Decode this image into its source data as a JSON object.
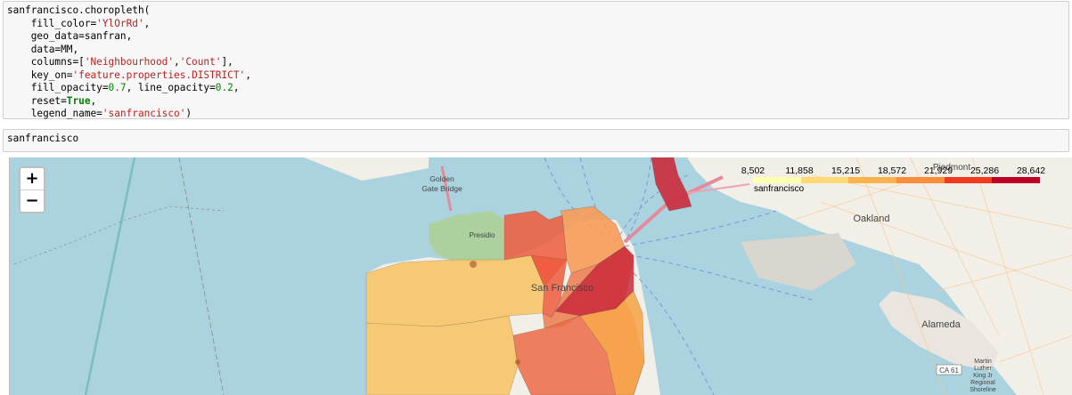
{
  "code_cell": {
    "lines": [
      [
        {
          "t": "sanfrancisco.choropleth("
        }
      ],
      [
        {
          "t": "    fill_color="
        },
        {
          "t": "'YlOrRd'",
          "c": "s"
        },
        {
          "t": ","
        }
      ],
      [
        {
          "t": "    geo_data=sanfran,"
        }
      ],
      [
        {
          "t": "    data=MM,"
        }
      ],
      [
        {
          "t": "    columns=["
        },
        {
          "t": "'Neighbourhood'",
          "c": "s"
        },
        {
          "t": ","
        },
        {
          "t": "'Count'",
          "c": "s"
        },
        {
          "t": "],"
        }
      ],
      [
        {
          "t": "    key_on="
        },
        {
          "t": "'feature.properties.DISTRICT'",
          "c": "s"
        },
        {
          "t": ","
        }
      ],
      [
        {
          "t": "    fill_opacity="
        },
        {
          "t": "0.7",
          "c": "n"
        },
        {
          "t": ", line_opacity="
        },
        {
          "t": "0.2",
          "c": "n"
        },
        {
          "t": ","
        }
      ],
      [
        {
          "t": "    reset="
        },
        {
          "t": "True",
          "c": "k"
        },
        {
          "t": ","
        }
      ],
      [
        {
          "t": "    legend_name="
        },
        {
          "t": "'sanfrancisco'",
          "c": "s"
        },
        {
          "t": ")"
        }
      ]
    ]
  },
  "input_cell2": {
    "code": "sanfrancisco"
  },
  "map": {
    "zoom_in_label": "+",
    "zoom_out_label": "−",
    "labels": {
      "golden_gate_1": "Golden",
      "golden_gate_2": "Gate Bridge",
      "presidio": "Presidio",
      "san_francisco": "San Francisco",
      "oakland": "Oakland",
      "alameda": "Alameda",
      "piedmont": "Piedmont",
      "ca61": "CA 61",
      "martin_1": "Martin",
      "martin_2": "Luther",
      "martin_3": "King Jr",
      "martin_4": "Regional",
      "martin_5": "Shoreline"
    },
    "legend": {
      "title": "sanfrancisco",
      "ticks": [
        "8,502",
        "11,858",
        "15,215",
        "18,572",
        "21,929",
        "25,286",
        "28,642"
      ],
      "colors": [
        "#ffffb2",
        "#fed976",
        "#feb24c",
        "#fd8d3c",
        "#f03b20",
        "#bd0026"
      ]
    }
  }
}
